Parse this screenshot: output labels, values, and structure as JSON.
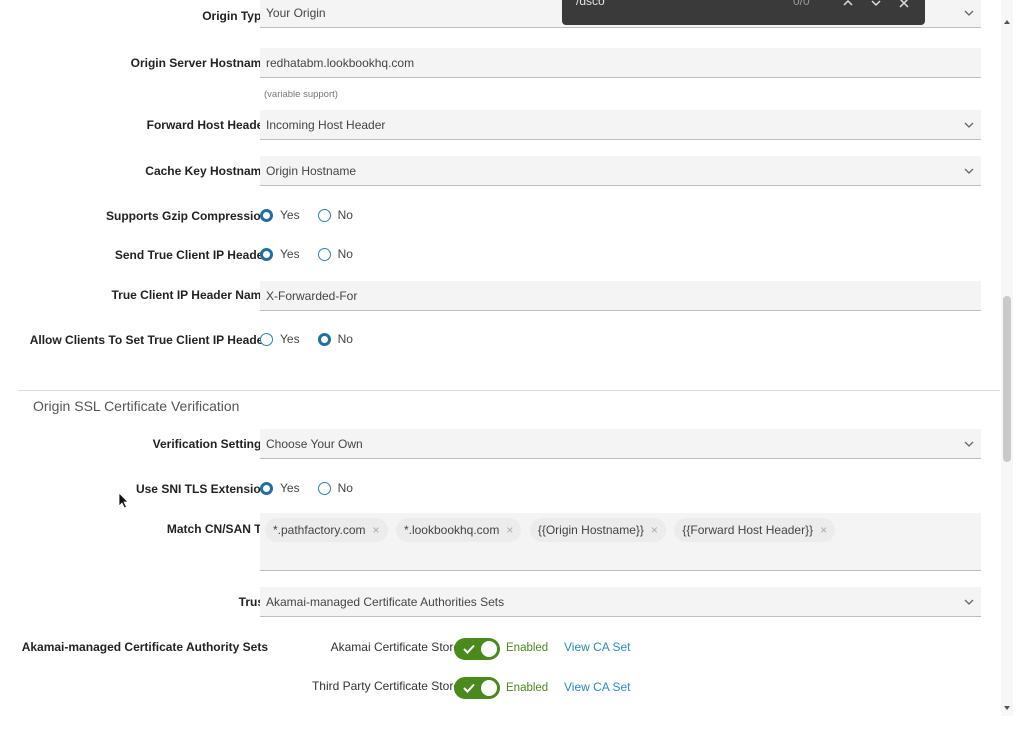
{
  "find_bar": {
    "query": "/dsco",
    "count": "0/0"
  },
  "origin_type": {
    "label": "Origin Type",
    "value": "Your Origin"
  },
  "origin_server_hostname": {
    "label": "Origin Server Hostname",
    "value": "redhatabm.lookbookhq.com",
    "hint": "(variable support)"
  },
  "forward_host_header": {
    "label": "Forward Host Header",
    "value": "Incoming Host Header"
  },
  "cache_key_hostname": {
    "label": "Cache Key Hostname",
    "value": "Origin Hostname"
  },
  "supports_gzip": {
    "label": "Supports Gzip Compression",
    "yes": "Yes",
    "no": "No",
    "selected": "yes"
  },
  "send_true_client_ip": {
    "label": "Send True Client IP Header",
    "yes": "Yes",
    "no": "No",
    "selected": "yes"
  },
  "true_client_ip_name": {
    "label": "True Client IP Header Name",
    "value": "X-Forwarded-For"
  },
  "allow_clients_set_ip": {
    "label": "Allow Clients To Set True Client IP Header",
    "yes": "Yes",
    "no": "No",
    "selected": "no"
  },
  "ssl_section": {
    "title": "Origin SSL Certificate Verification"
  },
  "verification_settings": {
    "label": "Verification Settings",
    "value": "Choose Your Own"
  },
  "use_sni": {
    "label": "Use SNI TLS Extension",
    "yes": "Yes",
    "no": "No",
    "selected": "yes"
  },
  "match_cn_san": {
    "label": "Match CN/SAN To",
    "chips": [
      "*.pathfactory.com",
      "*.lookbookhq.com",
      "{{Origin Hostname}}",
      "{{Forward Host Header}}"
    ],
    "remove_glyph": "×"
  },
  "trust": {
    "label": "Trust",
    "value": "Akamai-managed Certificate Authorities Sets"
  },
  "ca_sets": {
    "label": "Akamai-managed Certificate Authority Sets",
    "stores": [
      {
        "name": "Akamai Certificate Store",
        "status": "Enabled",
        "link": "View CA Set"
      },
      {
        "name": "Third Party Certificate Store",
        "status": "Enabled",
        "link": "View CA Set"
      }
    ]
  },
  "colors": {
    "accent": "#1f6fa3",
    "toggle_on": "#4a8a1c",
    "link": "#2a8bbd"
  },
  "icons": {
    "dropdown": "chevron-down-icon",
    "toggle": "check-icon",
    "find_up": "chevron-up-icon",
    "find_down": "chevron-down-icon",
    "find_close": "close-icon"
  }
}
